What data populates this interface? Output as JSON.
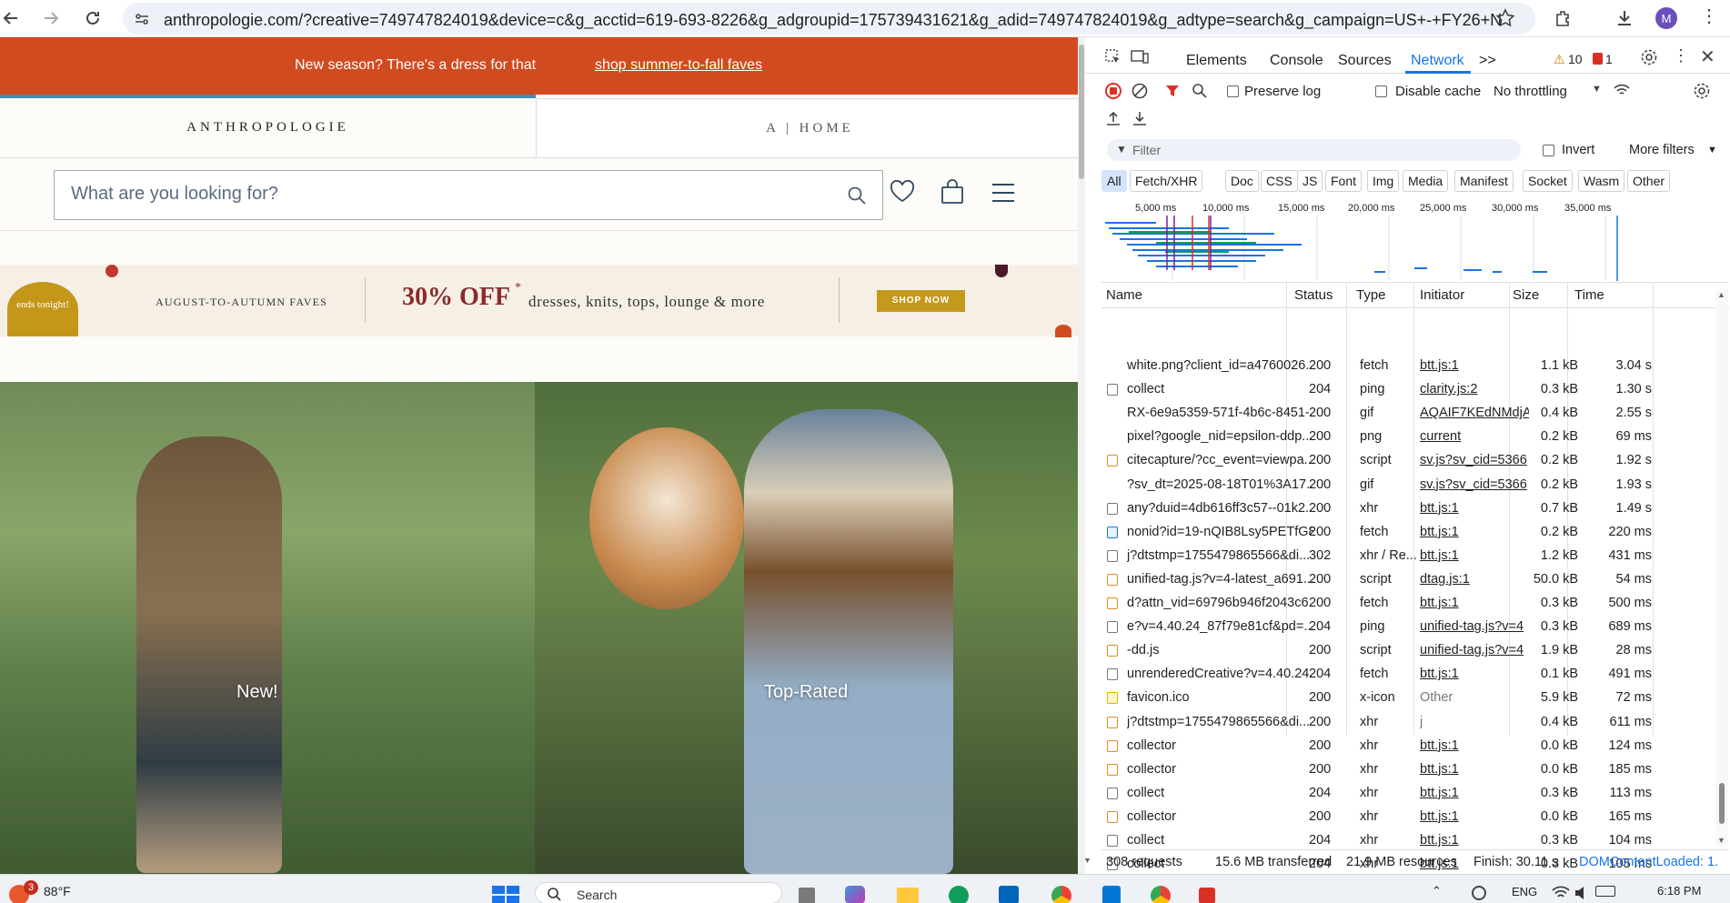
{
  "browser": {
    "url": "anthropologie.com/?creative=749747824019&device=c&g_acctid=619-693-8226&g_adgroupid=175739431621&g_adid=749747824019&g_adtype=search&g_campaign=US+-+FY26+N...",
    "profile_initial": "M"
  },
  "page": {
    "promo": {
      "text": "New season? There's a dress for that",
      "link": "shop summer-to-fall faves"
    },
    "tabs": {
      "main": "ANTHROPOLOGIE",
      "home": "A | HOME"
    },
    "search": {
      "placeholder": "What are you looking for?"
    },
    "banner": {
      "badge": "ends tonight!",
      "kicker": "AUGUST-TO-AUTUMN FAVES",
      "discount": "30% OFF",
      "discount_mark": "*",
      "detail": "dresses, knits, tops, lounge & more",
      "cta": "SHOP NOW"
    },
    "heroes": {
      "left_label": "New!",
      "right_label": "Top-Rated"
    }
  },
  "devtools": {
    "tabs": [
      "Elements",
      "Console",
      "Sources",
      "Network"
    ],
    "active_tab": "Network",
    "more_tabs": ">>",
    "warning_count": "10",
    "error_count": "1",
    "toolbar": {
      "preserve_log": "Preserve log",
      "disable_cache": "Disable cache",
      "throttling": "No throttling"
    },
    "filter": {
      "placeholder": "Filter",
      "invert": "Invert",
      "more_filters": "More filters"
    },
    "type_filters": [
      "All",
      "Fetch/XHR",
      "Doc",
      "CSS",
      "JS",
      "Font",
      "Img",
      "Media",
      "Manifest",
      "Socket",
      "Wasm",
      "Other"
    ],
    "timeline_ticks": [
      "5,000 ms",
      "10,000 ms",
      "15,000 ms",
      "20,000 ms",
      "25,000 ms",
      "30,000 ms",
      "35,000 ms"
    ],
    "columns": {
      "name": "Name",
      "status": "Status",
      "type": "Type",
      "initiator": "Initiator",
      "size": "Size",
      "time": "Time"
    },
    "rows": [
      {
        "name": "white.png?client_id=a4760026...",
        "status": "200",
        "type": "fetch",
        "initiator": "btt.js:1",
        "size": "1.1 kB",
        "time": "3.04 s",
        "icon": "none"
      },
      {
        "name": "collect",
        "status": "204",
        "type": "ping",
        "initiator": "clarity.js:2",
        "size": "0.3 kB",
        "time": "1.30 s",
        "icon": "file"
      },
      {
        "name": "RX-6e9a5359-571f-4b6c-8451-...",
        "status": "200",
        "type": "gif",
        "initiator": "AQAIF7KEdNMdjA",
        "size": "0.4 kB",
        "time": "2.55 s",
        "icon": "none"
      },
      {
        "name": "pixel?google_nid=epsilon-ddp...",
        "status": "200",
        "type": "png",
        "initiator": "current",
        "size": "0.2 kB",
        "time": "69 ms",
        "icon": "none"
      },
      {
        "name": "citecapture/?cc_event=viewpa...",
        "status": "200",
        "type": "script",
        "initiator": "sv.js?sv_cid=5366",
        "size": "0.2 kB",
        "time": "1.92 s",
        "icon": "script"
      },
      {
        "name": "?sv_dt=2025-08-18T01%3A17...",
        "status": "200",
        "type": "gif",
        "initiator": "sv.js?sv_cid=5366",
        "size": "0.2 kB",
        "time": "1.93 s",
        "icon": "none"
      },
      {
        "name": "any?duid=4db616ff3c57--01k2...",
        "status": "200",
        "type": "xhr",
        "initiator": "btt.js:1",
        "size": "0.7 kB",
        "time": "1.49 s",
        "icon": "file"
      },
      {
        "name": "nonid?id=19-nQIB8Lsy5PETfG8...",
        "status": "200",
        "type": "fetch",
        "initiator": "btt.js:1",
        "size": "0.2 kB",
        "time": "220 ms",
        "icon": "doc"
      },
      {
        "name": "j?dtstmp=1755479865566&di...",
        "status": "302",
        "type": "xhr / Re...",
        "initiator": "btt.js:1",
        "size": "1.2 kB",
        "time": "431 ms",
        "icon": "file"
      },
      {
        "name": "unified-tag.js?v=4-latest_a691...",
        "status": "200",
        "type": "script",
        "initiator": "dtag.js:1",
        "size": "50.0 kB",
        "time": "54 ms",
        "icon": "script"
      },
      {
        "name": "d?attn_vid=69796b946f2043c6...",
        "status": "200",
        "type": "fetch",
        "initiator": "btt.js:1",
        "size": "0.3 kB",
        "time": "500 ms",
        "icon": "script"
      },
      {
        "name": "e?v=4.40.24_87f79e81cf&pd=...",
        "status": "204",
        "type": "ping",
        "initiator": "unified-tag.js?v=4",
        "size": "0.3 kB",
        "time": "689 ms",
        "icon": "file"
      },
      {
        "name": "-dd.js",
        "status": "200",
        "type": "script",
        "initiator": "unified-tag.js?v=4",
        "size": "1.9 kB",
        "time": "28 ms",
        "icon": "script"
      },
      {
        "name": "unrenderedCreative?v=4.40.24...",
        "status": "204",
        "type": "fetch",
        "initiator": "btt.js:1",
        "size": "0.1 kB",
        "time": "491 ms",
        "icon": "file"
      },
      {
        "name": "favicon.ico",
        "status": "200",
        "type": "x-icon",
        "initiator": "Other",
        "size": "5.9 kB",
        "time": "72 ms",
        "icon": "img"
      },
      {
        "name": "j?dtstmp=1755479865566&di...",
        "status": "200",
        "type": "xhr",
        "initiator": "j",
        "size": "0.4 kB",
        "time": "611 ms",
        "icon": "script"
      },
      {
        "name": "collector",
        "status": "200",
        "type": "xhr",
        "initiator": "btt.js:1",
        "size": "0.0 kB",
        "time": "124 ms",
        "icon": "script"
      },
      {
        "name": "collector",
        "status": "200",
        "type": "xhr",
        "initiator": "btt.js:1",
        "size": "0.0 kB",
        "time": "185 ms",
        "icon": "script"
      },
      {
        "name": "collect",
        "status": "204",
        "type": "xhr",
        "initiator": "btt.js:1",
        "size": "0.3 kB",
        "time": "113 ms",
        "icon": "file"
      },
      {
        "name": "collector",
        "status": "200",
        "type": "xhr",
        "initiator": "btt.js:1",
        "size": "0.0 kB",
        "time": "165 ms",
        "icon": "script"
      },
      {
        "name": "collect",
        "status": "204",
        "type": "xhr",
        "initiator": "btt.js:1",
        "size": "0.3 kB",
        "time": "104 ms",
        "icon": "file"
      },
      {
        "name": "collect",
        "status": "204",
        "type": "xhr",
        "initiator": "btt.js:1",
        "size": "0.3 kB",
        "time": "105 ms",
        "icon": "file"
      }
    ],
    "status_bar": {
      "requests": "308 requests",
      "transferred": "15.6 MB transferred",
      "resources": "21.9 MB resources",
      "finish": "Finish: 30.11 s",
      "dcl": "DOMContentLoaded: 1."
    }
  },
  "taskbar": {
    "weather_badge": "3",
    "temperature": "88°F",
    "search_placeholder": "Search",
    "language": "ENG",
    "time": "6:18 PM"
  },
  "colors": {
    "promo_bg": "#d14b21",
    "accent_blue": "#1a73e8",
    "discount_red": "#8a2b2b",
    "cta_gold": "#c49a1c"
  }
}
